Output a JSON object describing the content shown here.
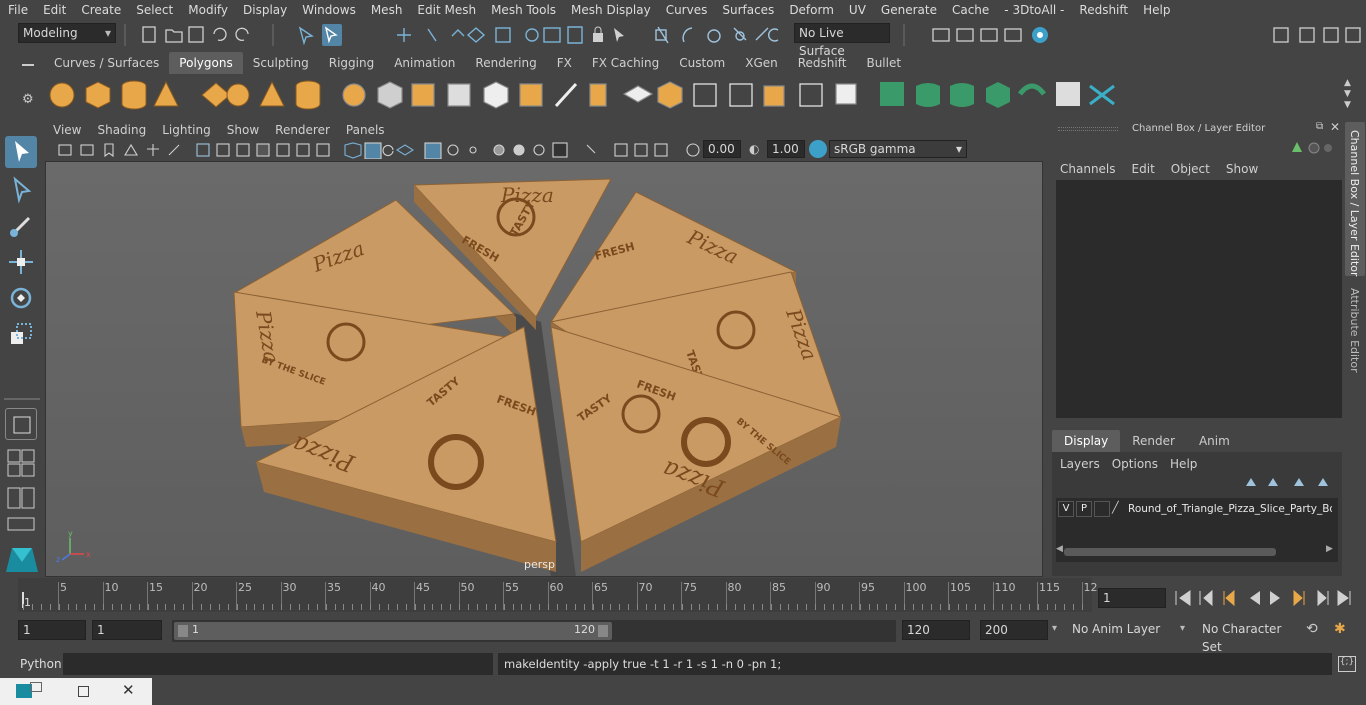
{
  "menubar": {
    "items": [
      "File",
      "Edit",
      "Create",
      "Select",
      "Modify",
      "Display",
      "Windows",
      "Mesh",
      "Edit Mesh",
      "Mesh Tools",
      "Mesh Display",
      "Curves",
      "Surfaces",
      "Deform",
      "UV",
      "Generate",
      "Cache",
      "- 3DtoAll -",
      "Redshift",
      "Help"
    ]
  },
  "status": {
    "mode": "Modeling",
    "live_surface": "No Live Surface"
  },
  "shelf": {
    "tabs": [
      "Curves / Surfaces",
      "Polygons",
      "Sculpting",
      "Rigging",
      "Animation",
      "Rendering",
      "FX",
      "FX Caching",
      "Custom",
      "XGen",
      "Redshift",
      "Bullet"
    ],
    "active_tab": "Polygons"
  },
  "viewport": {
    "menu": [
      "View",
      "Shading",
      "Lighting",
      "Show",
      "Renderer",
      "Panels"
    ],
    "exposure": "0.00",
    "gamma": "1.00",
    "color_space": "sRGB gamma",
    "camera_label": "persp",
    "scene": {
      "brand": "Pizza",
      "slogan_1": "FRESH",
      "slogan_2": "TASTY",
      "slogan_3": "BY THE SLICE"
    }
  },
  "right_panel": {
    "title": "Channel Box / Layer Editor",
    "channel_menu": [
      "Channels",
      "Edit",
      "Object",
      "Show"
    ],
    "layer_tabs": [
      "Display",
      "Render",
      "Anim"
    ],
    "active_layer_tab": "Display",
    "layer_menu": [
      "Layers",
      "Options",
      "Help"
    ],
    "layer": {
      "v": "V",
      "p": "P",
      "name": "Round_of_Triangle_Pizza_Slice_Party_Box"
    },
    "side_tabs": [
      "Channel Box / Layer Editor",
      "Attribute Editor"
    ]
  },
  "timeline": {
    "ticks": [
      "5",
      "10",
      "15",
      "20",
      "25",
      "30",
      "35",
      "40",
      "45",
      "50",
      "55",
      "60",
      "65",
      "70",
      "75",
      "80",
      "85",
      "90",
      "95",
      "100",
      "105",
      "110",
      "115",
      "12"
    ],
    "current_frame_marker": "1",
    "current_frame": "1"
  },
  "range": {
    "start": "1",
    "start2": "1",
    "slider_start": "1",
    "slider_end": "120",
    "end": "120",
    "max_end": "200",
    "anim_layer": "No Anim Layer",
    "char_set": "No Character Set"
  },
  "cmdline": {
    "language": "Python",
    "result": "makeIdentity -apply true -t 1 -r 1 -s 1 -n 0 -pn 1;"
  },
  "colors": {
    "accent": "#5285a6",
    "shelf_green": "#3a9a6a",
    "shelf_orange": "#e8a84a",
    "box_tan": "#c8975f",
    "print_brown": "#7a4a1e"
  }
}
